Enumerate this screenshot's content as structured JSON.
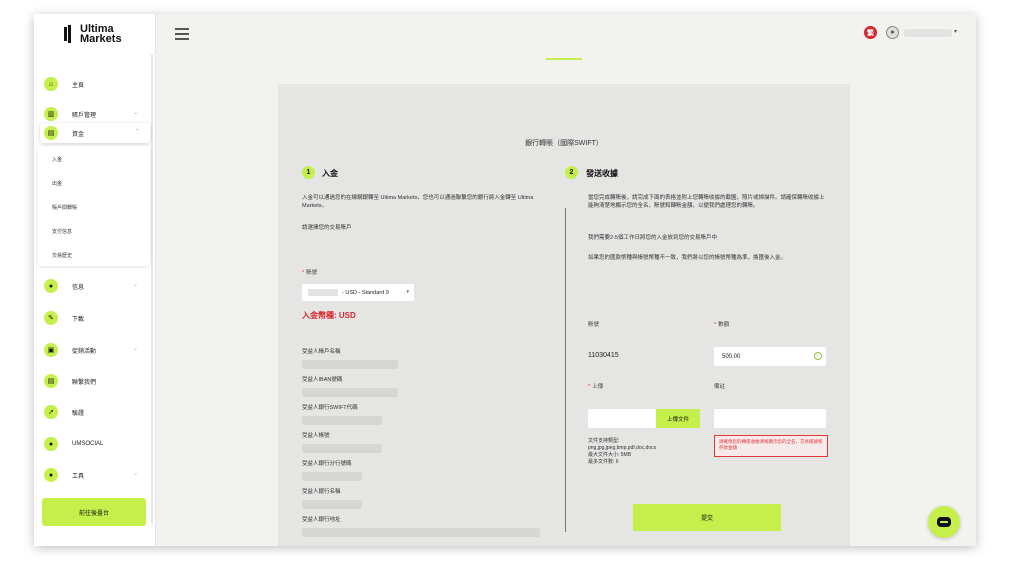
{
  "brand": {
    "line1": "Ultima",
    "line2": "Markets"
  },
  "sidebar": {
    "items": [
      {
        "label": "主頁",
        "icon": "home-icon",
        "glyph": "⌂"
      },
      {
        "label": "賬戶管理",
        "icon": "chart-icon",
        "glyph": "▥"
      },
      {
        "label": "資金",
        "icon": "wallet-icon",
        "glyph": "▤"
      },
      {
        "label": "信息",
        "icon": "person-icon",
        "glyph": "●"
      },
      {
        "label": "下載",
        "icon": "wrench-icon",
        "glyph": "✎"
      },
      {
        "label": "促銷活動",
        "icon": "gift-icon",
        "glyph": "▣"
      },
      {
        "label": "聯繫我們",
        "icon": "message-icon",
        "glyph": "▤"
      },
      {
        "label": "驗證",
        "icon": "rocket-icon",
        "glyph": "➚"
      },
      {
        "label": "UMSOCIAL",
        "icon": "person-icon",
        "glyph": "●"
      },
      {
        "label": "工具",
        "icon": "person-icon",
        "glyph": "●"
      }
    ],
    "submenu": [
      "入金",
      "出金",
      "賬戶間轉賬",
      "支付信息",
      "交易歷史"
    ],
    "backstage_button": "前往後臺台"
  },
  "header": {
    "lang_badge": "繁",
    "user_chevron": "▾"
  },
  "card": {
    "title": "銀行轉賬（國際SWIFT）",
    "step1": {
      "num": "1",
      "title": "入金",
      "desc": "入金可以通過您的在線網銀轉至 Ultima Markets，您也可以通過聯繫您的銀行將入金轉至 Ultima Markets。",
      "choose": "請選擇您的交易賬戶",
      "account_label": "賬號",
      "account_value": "- USD - Standard 9",
      "currency": "入金幣種: USD",
      "fields": [
        "受益人帳戶名稱",
        "受益人IBAN號碼",
        "受益人銀行SWIFT代碼",
        "受益人帳號",
        "受益人銀行分行號碼",
        "受益人銀行名稱",
        "受益人銀行地址"
      ]
    },
    "step2": {
      "num": "2",
      "title": "發送收據",
      "desc": "當您完成轉賬後，請完成下面的表格並附上您轉賬收據的截圖，照片或掃描件。請確保轉賬收據上能夠清楚地顯示您的全名，賬號和轉賬金額，以便我們處理您的轉賬。",
      "notice1": "我們需要2-5個工作日將您的入金放到您的交易賬戶中",
      "notice2": "如果您的匯款幣種與帳號幣種不一致，我們將以您的帳號幣種為準，換匯後入金。",
      "account_label": "賬號",
      "account_value": "11030415",
      "amount_label": "數額",
      "amount_value": "500.00",
      "upload_label": "上傳",
      "upload_button": "上傳文件",
      "remark_label": "備註",
      "file_types": "文件支持類型:",
      "file_types_value": "png,jpg,jpeg,bmp,pdf,doc,docx",
      "max_size": "最大文件大小: 5MB",
      "max_files": "最多文件數: 6",
      "warning": "請確保您的轉賬收據清晰顯示您的全名，交易帳號和存款金額",
      "submit": "提交"
    }
  }
}
